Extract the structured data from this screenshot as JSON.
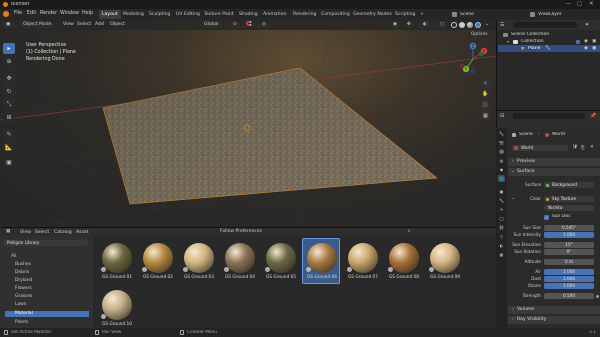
{
  "window": {
    "title": "Blender"
  },
  "menus": [
    "File",
    "Edit",
    "Render",
    "Window",
    "Help"
  ],
  "workspaces": [
    "Layout",
    "Modeling",
    "Sculpting",
    "UV Editing",
    "Texture Paint",
    "Shading",
    "Animation",
    "Rendering",
    "Compositing",
    "Geometry Nodes",
    "Scripting"
  ],
  "workspace_add": "+",
  "scene": {
    "label": "Scene",
    "view_layer": "ViewLayer"
  },
  "viewport": {
    "mode": "Object Mode",
    "menus": [
      "View",
      "Select",
      "Add",
      "Object"
    ],
    "orientation": "Global",
    "overlay_lines": [
      "User Perspective",
      "(1) Collection | Plane",
      "Rendering Done"
    ],
    "options_label": "Options",
    "gizmo": {
      "x": "X",
      "y": "Y",
      "z": "Z"
    }
  },
  "asset_browser": {
    "menus": [
      "View",
      "Select",
      "Catalog",
      "Asset"
    ],
    "filter": "Follow Preferences",
    "library": "Poliigon Library",
    "catalogs": [
      "All",
      "Bushes",
      "Debris",
      "Dryland",
      "Flowers",
      "Grasses",
      "Lawn",
      "Material",
      "Plants"
    ],
    "selected_catalog": "Material",
    "assets": [
      {
        "name": "GS Ground 01",
        "color": "#6d6640"
      },
      {
        "name": "GS Ground 02",
        "color": "#b58a40"
      },
      {
        "name": "GS Ground 03",
        "color": "#d2b784"
      },
      {
        "name": "GS Ground 04",
        "color": "#8a7358"
      },
      {
        "name": "GS Ground 05",
        "color": "#6b6846"
      },
      {
        "name": "GS Ground 06",
        "color": "#a87a45"
      },
      {
        "name": "GS Ground 07",
        "color": "#c9a56e"
      },
      {
        "name": "GS Ground 08",
        "color": "#a8703a"
      },
      {
        "name": "GS Ground 09",
        "color": "#d6b686"
      },
      {
        "name": "GS Ground 10",
        "color": "#c4b08a"
      }
    ],
    "selected_asset": "GS Ground 06"
  },
  "statusbar": {
    "left": "Set Active Modifier",
    "middle": "Pan View",
    "right": "Context Menu",
    "version": "3.1"
  },
  "outliner": {
    "title": "Scene Collection",
    "items": [
      "Collection",
      "Plane"
    ]
  },
  "properties": {
    "breadcrumb": [
      "Scene",
      "World"
    ],
    "world_name": "World",
    "panels": {
      "preview": "Preview",
      "surface": "Surface",
      "volume": "Volume",
      "ray_visibility": "Ray Visibility"
    },
    "surface": {
      "label": "Surface",
      "value": "Background"
    },
    "color": {
      "label": "Color",
      "value": "Sky Texture"
    },
    "sky_type": "Nishita",
    "sun_disc": {
      "label": "Sun Disc",
      "checked": true
    },
    "rows": [
      {
        "label": "Sun Size",
        "value": "0.545°",
        "style": "normal"
      },
      {
        "label": "Sun Intensity",
        "value": "1.000",
        "style": "blue"
      },
      {
        "label": "Sun Elevation",
        "value": "15°",
        "style": "normal"
      },
      {
        "label": "Sun Rotation",
        "value": "0°",
        "style": "normal"
      },
      {
        "label": "Altitude",
        "value": "0 m",
        "style": "normal"
      },
      {
        "label": "Air",
        "value": "1.000",
        "style": "blue"
      },
      {
        "label": "Dust",
        "value": "1.000",
        "style": "blue"
      },
      {
        "label": "Ozone",
        "value": "1.000",
        "style": "blue"
      },
      {
        "label": "Strength",
        "value": "0.500",
        "style": "normal"
      }
    ]
  },
  "colors": {
    "accent": "#4772b3",
    "header": "#262626",
    "panel": "#2b2b2b"
  }
}
